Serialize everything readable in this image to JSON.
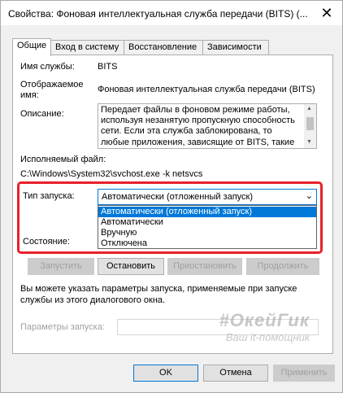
{
  "window": {
    "title": "Свойства: Фоновая интеллектуальная служба передачи (BITS) (...",
    "close_glyph": "✕"
  },
  "tabs": [
    {
      "label": "Общие",
      "active": true
    },
    {
      "label": "Вход в систему",
      "active": false
    },
    {
      "label": "Восстановление",
      "active": false
    },
    {
      "label": "Зависимости",
      "active": false
    }
  ],
  "general": {
    "service_name_label": "Имя службы:",
    "service_name_value": "BITS",
    "display_name_label_line1": "Отображаемое",
    "display_name_label_line2": "имя:",
    "display_name_value": "Фоновая интеллектуальная служба передачи (BITS)",
    "description_label": "Описание:",
    "description_lines": [
      "Передает файлы в фоновом режиме работы,",
      "используя незанятую пропускную способность",
      "сети. Если эта служба заблокирована, то",
      "любые приложения, зависящие от BITS, такие"
    ],
    "exe_label": "Исполняемый файл:",
    "exe_value": "C:\\Windows\\System32\\svchost.exe -k netsvcs",
    "startup_type_label": "Тип запуска:",
    "startup_type_value": "Автоматически (отложенный запуск)",
    "startup_options": [
      "Автоматически (отложенный запуск)",
      "Автоматически",
      "Вручную",
      "Отключена"
    ],
    "status_label": "Состояние:",
    "buttons": {
      "start": "Запустить",
      "stop": "Остановить",
      "pause": "Приостановить",
      "resume": "Продолжить"
    },
    "hint_line1": "Вы можете указать параметры запуска, применяемые при запуске",
    "hint_line2": "службы из этого диалогового окна.",
    "start_params_label": "Параметры запуска:",
    "start_params_value": ""
  },
  "footer": {
    "ok": "OK",
    "cancel": "Отмена",
    "apply": "Применить"
  },
  "watermark": {
    "main": "#ОкейГик",
    "sub": "Ваш it-помощник"
  },
  "colors": {
    "accent": "#0078d7",
    "highlight_frame": "#e8202b",
    "disabled_text": "#a0a0a0"
  }
}
